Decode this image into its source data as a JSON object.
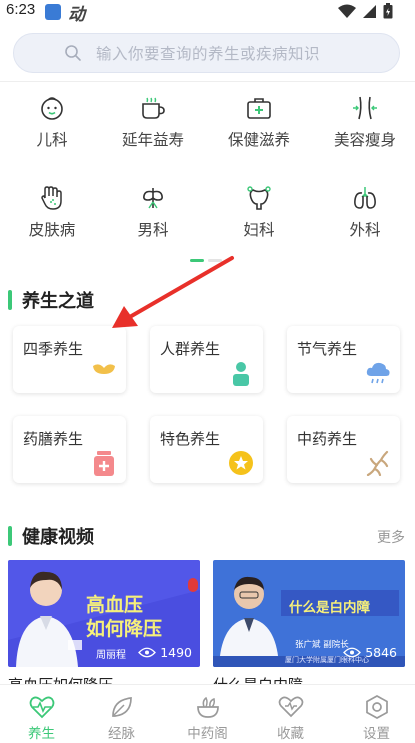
{
  "status_bar": {
    "time": "6:23",
    "app_glyph": "动"
  },
  "search": {
    "placeholder": "输入你要查询的养生或疾病知识"
  },
  "categories": [
    {
      "label": "儿科",
      "icon": "baby-face-icon"
    },
    {
      "label": "延年益寿",
      "icon": "teacup-icon"
    },
    {
      "label": "保健滋养",
      "icon": "medical-kit-icon"
    },
    {
      "label": "美容瘦身",
      "icon": "waist-slim-icon"
    },
    {
      "label": "皮肤病",
      "icon": "hand-skin-icon"
    },
    {
      "label": "男科",
      "icon": "male-organ-icon"
    },
    {
      "label": "妇科",
      "icon": "uterus-icon"
    },
    {
      "label": "外科",
      "icon": "lungs-icon"
    }
  ],
  "section_wellness": {
    "title": "养生之道",
    "cards": [
      {
        "label": "四季养生",
        "icon": "ginkgo-leaf-icon"
      },
      {
        "label": "人群养生",
        "icon": "person-icon"
      },
      {
        "label": "节气养生",
        "icon": "rain-cloud-icon"
      },
      {
        "label": "药膳养生",
        "icon": "medicine-bottle-icon"
      },
      {
        "label": "特色养生",
        "icon": "star-badge-icon"
      },
      {
        "label": "中药养生",
        "icon": "ginseng-root-icon"
      }
    ]
  },
  "section_video": {
    "title": "健康视频",
    "more": "更多",
    "videos": [
      {
        "overlay_title_1": "高血压",
        "overlay_title_2": "如何降压",
        "doctor_tag": "周丽程",
        "views": "1490",
        "caption": "高血压如何降压"
      },
      {
        "overlay_title_1": "什么是白内障",
        "doctor_tag": "张广斌  副院长",
        "org_tag": "厦门大学附属厦门眼科中心",
        "views": "5846",
        "caption": "什么是白内障"
      }
    ]
  },
  "tabbar": [
    {
      "label": "养生",
      "icon": "heart-pulse-icon",
      "active": true
    },
    {
      "label": "经脉",
      "icon": "leaf-icon",
      "active": false
    },
    {
      "label": "中药阁",
      "icon": "herb-bowl-icon",
      "active": false
    },
    {
      "label": "收藏",
      "icon": "heart-outline-icon",
      "active": false
    },
    {
      "label": "设置",
      "icon": "settings-hexagon-icon",
      "active": false
    }
  ],
  "colors": {
    "accent": "#3cc878",
    "annotation_arrow": "#e8302a",
    "video_bg": "#4a4ee0"
  }
}
